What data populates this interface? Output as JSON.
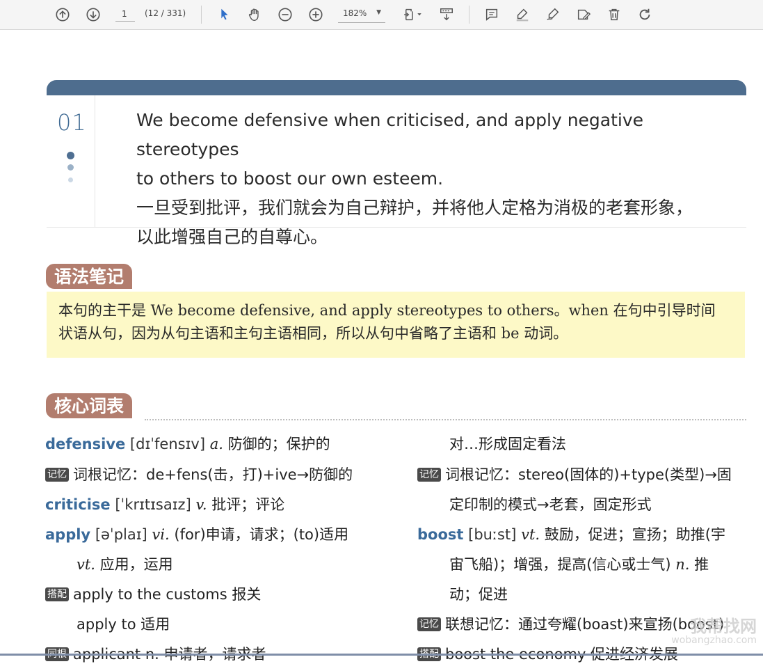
{
  "toolbar": {
    "page_current": "1",
    "page_count": "(12 / 331)",
    "zoom": "182%"
  },
  "sentence": {
    "number": "01",
    "english_1": "We become defensive when criticised, and apply negative stereotypes",
    "english_2": "to others to boost our own esteem.",
    "chinese_1": "一旦受到批评，我们就会为自己辩护，并将他人定格为消极的老套形象，",
    "chinese_2": "以此增强自己的自尊心。"
  },
  "grammar": {
    "title": "语法笔记",
    "line_1": "本句的主干是 We become defensive, and apply stereotypes to others。when 在句中引导时间",
    "line_2": "状语从句，因为从句主语和主句主语相同，所以从句中省略了主语和 be 动词。"
  },
  "vocab": {
    "title": "核心词表",
    "left": {
      "w1_word": "defensive",
      "w1_phon": "[dɪˈfensɪv]",
      "w1_pos": "a.",
      "w1_def": "防御的；保护的",
      "w1_badge": "记忆",
      "w1_mem": "词根记忆：de+fens(击，打)+ive→防御的",
      "w2_word": "criticise",
      "w2_phon": "[ˈkrɪtɪsaɪz]",
      "w2_pos": "v.",
      "w2_def": "批评；评论",
      "w3_word": "apply",
      "w3_phon": "[əˈplaɪ]",
      "w3_pos": "vi.",
      "w3_def": "(for)申请，请求；(to)适用",
      "w3_pos2": "vt.",
      "w3_def2": "应用，运用",
      "w3_badge": "搭配",
      "w3_col1": "apply to the customs 报关",
      "w3_col2": "apply to 适用",
      "w3_badge2": "同根",
      "w3_root": "applicant n. 申请者，请求者"
    },
    "right": {
      "cont": "对…形成固定看法",
      "badge1": "记忆",
      "mem1a": "词根记忆：stereo(固体的)+type(类型)→固",
      "mem1b": "定印制的模式→老套，固定形式",
      "w_word": "boost",
      "w_phon": "[buːst]",
      "w_pos": "vt.",
      "w_def1": "鼓励，促进；宣扬；助推(宇",
      "w_def2": "宙飞船)；增强，提高(信心或士气)",
      "w_pos2": "n.",
      "w_def2b": "推",
      "w_def3": "动；促进",
      "badge2": "记忆",
      "mem2": "联想记忆：通过夸耀(boast)来宣扬(boost)",
      "badge3": "搭配",
      "col": "boost the economy 促进经济发展"
    }
  },
  "watermark": {
    "text": "我帮找网",
    "url": "wobangzhao.com"
  }
}
